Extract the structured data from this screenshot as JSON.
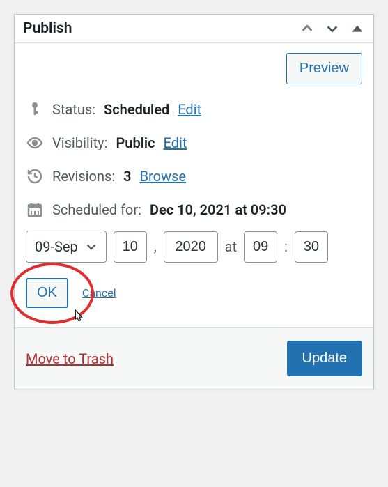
{
  "panel": {
    "title": "Publish"
  },
  "preview": {
    "label": "Preview"
  },
  "status": {
    "label": "Status:",
    "value": "Scheduled",
    "edit": "Edit"
  },
  "visibility": {
    "label": "Visibility:",
    "value": "Public",
    "edit": "Edit"
  },
  "revisions": {
    "label": "Revisions:",
    "value": "3",
    "browse": "Browse"
  },
  "schedule": {
    "label": "Scheduled for:",
    "value": "Dec 10, 2021 at 09:30"
  },
  "date_editor": {
    "month": "09-Sep",
    "day": "10",
    "year": "2020",
    "at": "at",
    "hour": "09",
    "minute": "30",
    "sep_comma": ",",
    "sep_colon": ":"
  },
  "ok_label": "OK",
  "cancel_label": "Cancel",
  "trash_label": "Move to Trash",
  "update_label": "Update"
}
